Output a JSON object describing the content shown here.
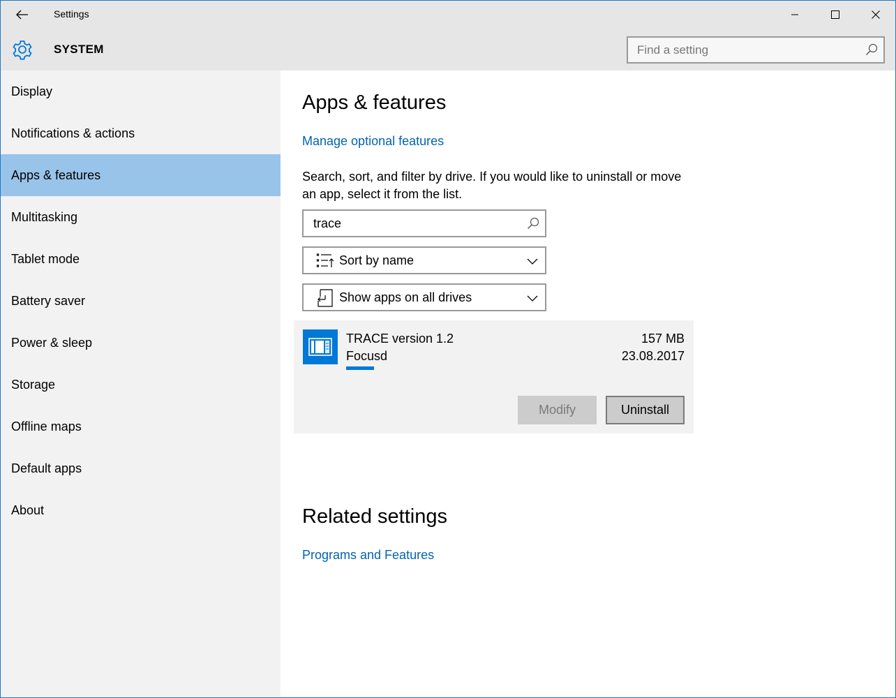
{
  "window": {
    "title": "Settings",
    "controls": {
      "back": "back-arrow-icon",
      "minimize": "minimize-icon",
      "maximize": "maximize-icon",
      "close": "close-icon"
    }
  },
  "header": {
    "icon": "gear-icon",
    "section": "SYSTEM",
    "search": {
      "placeholder": "Find a setting",
      "value": ""
    }
  },
  "sidebar": {
    "items": [
      {
        "label": "Display"
      },
      {
        "label": "Notifications & actions"
      },
      {
        "label": "Apps & features",
        "active": true
      },
      {
        "label": "Multitasking"
      },
      {
        "label": "Tablet mode"
      },
      {
        "label": "Battery saver"
      },
      {
        "label": "Power & sleep"
      },
      {
        "label": "Storage"
      },
      {
        "label": "Offline maps"
      },
      {
        "label": "Default apps"
      },
      {
        "label": "About"
      }
    ]
  },
  "main": {
    "title": "Apps & features",
    "manage_link": "Manage optional features",
    "description": "Search, sort, and filter by drive. If you would like to uninstall or move an app, select it from the list.",
    "search": {
      "value": "trace"
    },
    "sort": {
      "selected": "Sort by name",
      "icon": "sort-list-icon"
    },
    "drive_filter": {
      "selected": "Show apps on all drives",
      "icon": "drive-filter-icon"
    },
    "apps": [
      {
        "name": "TRACE version 1.2",
        "publisher": "Focusd",
        "size": "157 MB",
        "date": "23.08.2017",
        "icon": "app-window-icon",
        "modify_label": "Modify",
        "uninstall_label": "Uninstall"
      }
    ],
    "related_title": "Related settings",
    "related_link": "Programs and Features"
  },
  "colors": {
    "accent": "#0078d7",
    "link": "#0063b1",
    "sidebar_active": "#99c4e9",
    "titlebar_bg": "#e6e6e6",
    "sidebar_bg": "#f2f2f2"
  }
}
